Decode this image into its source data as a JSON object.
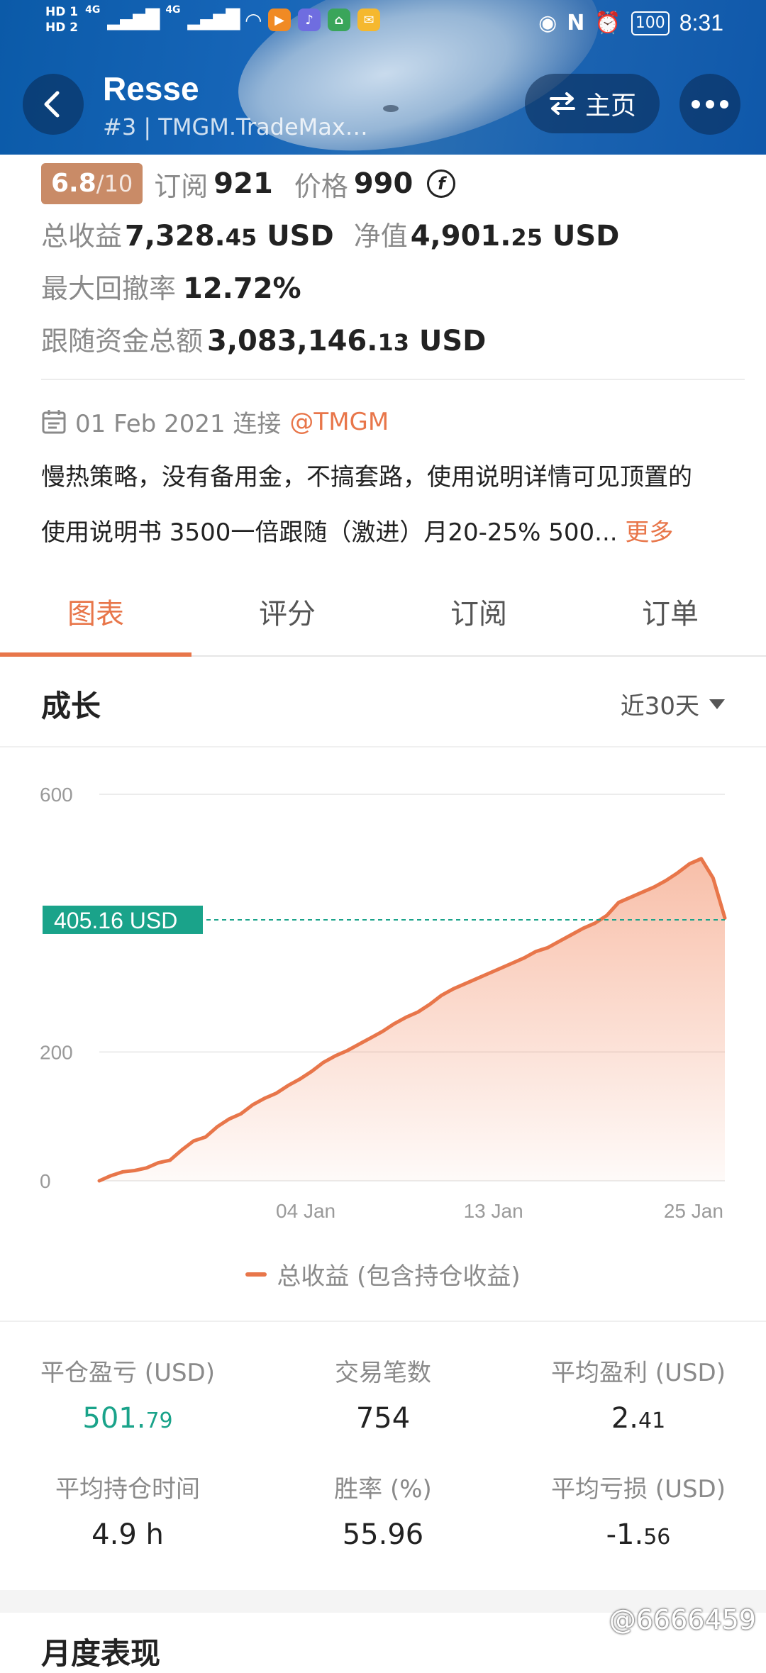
{
  "status_bar": {
    "hd1": "HD 1",
    "hd2": "HD 2",
    "net1": "4G",
    "net2": "4G",
    "battery": "100",
    "time": "8:31"
  },
  "header": {
    "title": "Resse",
    "subtitle": "#3 | TMGM.TradeMax…",
    "home_label": "主页"
  },
  "info": {
    "rating": "6.8",
    "rating_max": "/10",
    "subscribe_label": "订阅",
    "subscribe_count": "921",
    "price_label": "价格",
    "price_value": "990",
    "price_coin": "f",
    "total_profit_label": "总收益",
    "total_profit_int": "7,328.",
    "total_profit_dec": "45",
    "total_profit_unit": " USD",
    "equity_label": "净值",
    "equity_int": "4,901.",
    "equity_dec": "25",
    "equity_unit": " USD",
    "drawdown_label": "最大回撤率",
    "drawdown_value": "12.72%",
    "follow_label": "跟随资金总额",
    "follow_int": "3,083,146.",
    "follow_dec": "13",
    "follow_unit": " USD",
    "date_text": "01 Feb 2021 连接",
    "broker": "@TMGM",
    "desc_line1": "慢热策略，没有备用金，不搞套路，使用说明详情可见顶置的",
    "desc_line2": "使用说明书 3500一倍跟随（激进）月20-25% 500...",
    "more_link": "更多"
  },
  "tabs": [
    "图表",
    "评分",
    "订阅",
    "订单"
  ],
  "growth": {
    "title": "成长",
    "range": "近30天"
  },
  "chart_data": {
    "type": "area",
    "x_ticks": [
      "04 Jan",
      "13 Jan",
      "25 Jan"
    ],
    "y_ticks": [
      "600",
      "200",
      "0"
    ],
    "ylim": [
      0,
      600
    ],
    "current_label": "405.16 USD",
    "current_value": 405.16,
    "series": [
      {
        "name": "总收益 (包含持仓收益)",
        "values": [
          0,
          8,
          14,
          16,
          20,
          28,
          32,
          48,
          62,
          68,
          84,
          96,
          104,
          118,
          128,
          136,
          148,
          158,
          170,
          184,
          194,
          202,
          212,
          222,
          232,
          244,
          254,
          262,
          274,
          288,
          298,
          306,
          314,
          322,
          330,
          338,
          346,
          356,
          362,
          372,
          382,
          392,
          400,
          412,
          432,
          440,
          448,
          456,
          466,
          478,
          492,
          500,
          470,
          408
        ]
      }
    ],
    "legend": "总收益 (包含持仓收益)",
    "grid": true
  },
  "stats": [
    {
      "label": "平仓盈亏 (USD)",
      "int": "501.",
      "dec": "79",
      "accent": true
    },
    {
      "label": "交易笔数",
      "int": "754",
      "dec": "",
      "accent": false
    },
    {
      "label": "平均盈利 (USD)",
      "int": "2.",
      "dec": "41",
      "accent": false
    },
    {
      "label": "平均持仓时间",
      "int": "4.9 h",
      "dec": "",
      "accent": false
    },
    {
      "label": "胜率 (%)",
      "int": "55.96",
      "dec": "",
      "accent": false
    },
    {
      "label": "平均亏损 (USD)",
      "int": "-1.",
      "dec": "56",
      "accent": false
    }
  ],
  "monthly_title": "月度表现",
  "watermark": "@6666459",
  "colors": {
    "accent": "#e8764a",
    "green": "#1aa38a",
    "header_blue": "#1766b9"
  }
}
